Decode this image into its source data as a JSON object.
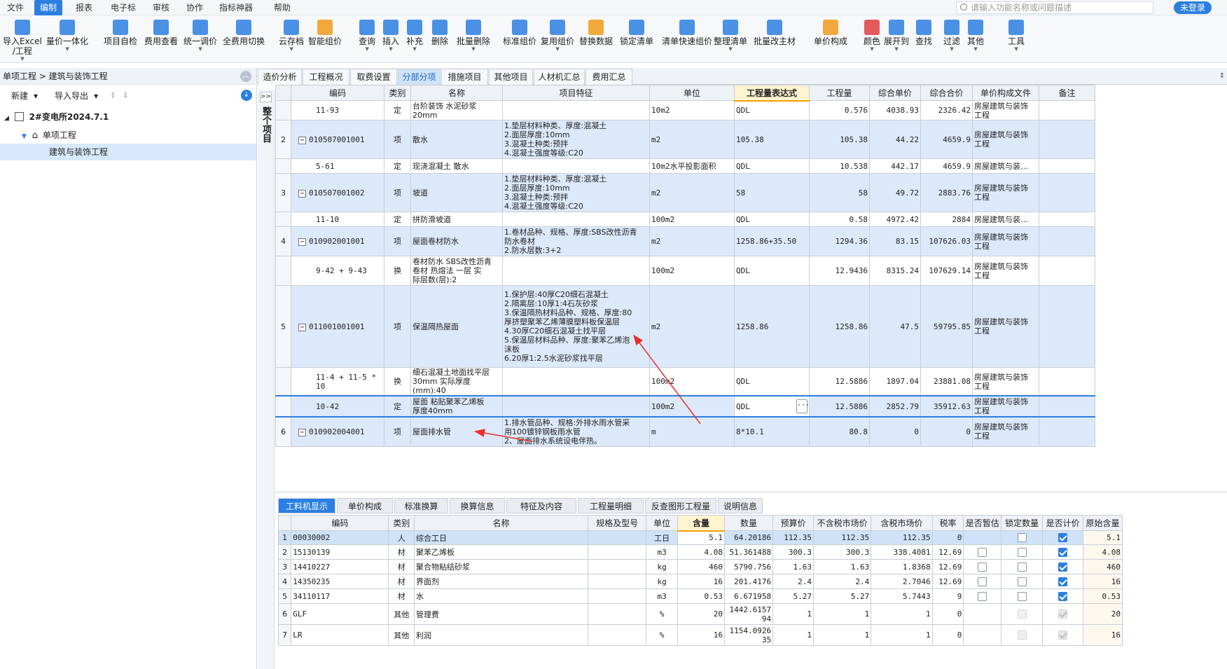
{
  "menu": [
    "文件",
    "编制",
    "报表",
    "电子标",
    "审核",
    "协作",
    "指标神器",
    "帮助"
  ],
  "menu_active_index": 1,
  "search_placeholder": "请输入功能名称或问题描述",
  "login_label": "未登录",
  "toolbar": [
    {
      "label": "导入Excel\n/工程",
      "icon": "import-excel-icon",
      "dd": true
    },
    {
      "label": "量价一体化",
      "icon": "quantity-price-icon",
      "dd": true
    },
    {
      "label": "项目自检",
      "icon": "self-check-icon",
      "dd": false
    },
    {
      "label": "费用查看",
      "icon": "fee-view-icon",
      "dd": false
    },
    {
      "label": "统一调价",
      "icon": "unified-price-icon",
      "dd": true
    },
    {
      "label": "全费用切换",
      "icon": "full-fee-switch-icon",
      "dd": false
    },
    {
      "label": "云存档",
      "icon": "cloud-archive-icon",
      "dd": true
    },
    {
      "label": "智能组价",
      "icon": "smart-pricing-icon",
      "dd": false
    },
    {
      "label": "查询",
      "icon": "query-icon",
      "dd": true
    },
    {
      "label": "插入",
      "icon": "insert-icon",
      "dd": true
    },
    {
      "label": "补充",
      "icon": "supplement-icon",
      "dd": true
    },
    {
      "label": "删除",
      "icon": "delete-icon",
      "dd": false
    },
    {
      "label": "批量删除",
      "icon": "batch-delete-icon",
      "dd": true
    },
    {
      "label": "标准组价",
      "icon": "standard-pricing-icon",
      "dd": false
    },
    {
      "label": "复用组价",
      "icon": "reuse-pricing-icon",
      "dd": true
    },
    {
      "label": "替换数据",
      "icon": "replace-data-icon",
      "dd": false
    },
    {
      "label": "锁定清单",
      "icon": "lock-list-icon",
      "dd": false
    },
    {
      "label": "清单快速组价",
      "icon": "quick-pricing-icon",
      "dd": false
    },
    {
      "label": "整理清单",
      "icon": "organize-list-icon",
      "dd": true
    },
    {
      "label": "批量改主材",
      "icon": "batch-material-icon",
      "dd": false
    },
    {
      "label": "单价构成",
      "icon": "unit-price-icon",
      "dd": false
    },
    {
      "label": "颜色",
      "icon": "color-icon",
      "dd": true
    },
    {
      "label": "展开到",
      "icon": "expand-to-icon",
      "dd": true
    },
    {
      "label": "查找",
      "icon": "find-icon",
      "dd": false
    },
    {
      "label": "过滤",
      "icon": "filter-icon",
      "dd": true
    },
    {
      "label": "其他",
      "icon": "other-icon",
      "dd": true
    },
    {
      "label": "工具",
      "icon": "tools-icon",
      "dd": true
    }
  ],
  "left": {
    "breadcrumb": "单项工程 > 建筑与装饰工程",
    "new_label": "新建",
    "import_export_label": "导入导出",
    "tree": [
      {
        "label": "2#变电所2024.7.1",
        "level": 0,
        "icon": "building-icon"
      },
      {
        "label": "单项工程",
        "level": 1,
        "icon": "home-icon"
      },
      {
        "label": "建筑与装饰工程",
        "level": 2,
        "icon": ""
      }
    ],
    "strip_label": "整个项目"
  },
  "tabs": [
    "造价分析",
    "工程概况",
    "取费设置",
    "分部分项",
    "措施项目",
    "其他项目",
    "人材机汇总",
    "费用汇总"
  ],
  "active_tab": "分部分项",
  "main_headers": [
    "",
    "编码",
    "类别",
    "名称",
    "项目特征",
    "单位",
    "工程量表达式",
    "工程量",
    "综合单价",
    "综合合价",
    "单价构成文件",
    "备注"
  ],
  "main_rows": [
    {
      "seq": "",
      "code": "11-93",
      "type": "定",
      "name": "台阶装饰 水泥砂浆\n20mm",
      "feature": "",
      "unit": "10m2",
      "expr": "QDL",
      "qty": "0.576",
      "price": "4038.93",
      "total": "2326.42",
      "file": "房屋建筑与装饰\n工程",
      "kind": "sub",
      "h": 28
    },
    {
      "seq": "2",
      "code": "010507001001",
      "type": "项",
      "name": "散水",
      "feature": "1.垫层材料种类、厚度:混凝土\n2.面层厚度:10mm\n3.混凝土种类:预拌\n4.混凝土强度等级:C20",
      "unit": "m2",
      "expr": "105.38",
      "qty": "105.38",
      "price": "44.22",
      "total": "4659.9",
      "file": "房屋建筑与装饰\n工程",
      "kind": "item",
      "h": 55
    },
    {
      "seq": "",
      "code": "5-61",
      "type": "定",
      "name": "现浇混凝土 散水",
      "feature": "",
      "unit": "10m2水平投影面积",
      "expr": "QDL",
      "qty": "10.538",
      "price": "442.17",
      "total": "4659.9",
      "file": "房屋建筑与装…",
      "kind": "sub",
      "h": 21
    },
    {
      "seq": "3",
      "code": "010507001002",
      "type": "项",
      "name": "坡道",
      "feature": "1.垫层材料种类、厚度:混凝土\n2.面层厚度:10mm\n3.混凝土种类:预拌\n4.混凝土强度等级:C20",
      "unit": "m2",
      "expr": "58",
      "qty": "58",
      "price": "49.72",
      "total": "2883.76",
      "file": "房屋建筑与装饰\n工程",
      "kind": "item",
      "h": 55
    },
    {
      "seq": "",
      "code": "11-10",
      "type": "定",
      "name": "拼防滑坡道",
      "feature": "",
      "unit": "100m2",
      "expr": "QDL",
      "qty": "0.58",
      "price": "4972.42",
      "total": "2884",
      "file": "房屋建筑与装…",
      "kind": "sub",
      "h": 21
    },
    {
      "seq": "4",
      "code": "010902001001",
      "type": "项",
      "name": "屋面卷材防水",
      "feature": "1.卷材品种、规格、厚度:SBS改性沥青\n防水卷材\n2.防水层数:3+2",
      "unit": "m2",
      "expr": "1258.86+35.50",
      "qty": "1294.36",
      "price": "83.15",
      "total": "107626.03",
      "file": "房屋建筑与装饰\n工程",
      "kind": "item",
      "h": 42
    },
    {
      "seq": "",
      "code": "9-42 + 9-43",
      "type": "换",
      "name": "卷材防水 SBS改性沥青\n卷材 热熔法 一层 实\n际层数(层):2",
      "feature": "",
      "unit": "100m2",
      "expr": "QDL",
      "qty": "12.9436",
      "price": "8315.24",
      "total": "107629.14",
      "file": "房屋建筑与装饰\n工程",
      "kind": "sub",
      "h": 42
    },
    {
      "seq": "5",
      "code": "011001001001",
      "type": "项",
      "name": "保温隔热屋面",
      "feature": "1.保护层:40厚C20细石混凝土\n2.隔离层:10厚1:4石灰砂浆\n3.保温隔热材料品种、规格、厚度:80\n厚挤塑聚苯乙烯薄膜塑料板保温层\n4.30厚C20细石混凝土找平层\n5.保温层材料品种、厚度:聚苯乙烯泡\n沫板\n6.20厚1:2.5水泥砂浆找平层",
      "unit": "m2",
      "expr": "1258.86",
      "qty": "1258.86",
      "price": "47.5",
      "total": "59795.85",
      "file": "房屋建筑与装饰\n工程",
      "kind": "item",
      "h": 117
    },
    {
      "seq": "",
      "code": "11-4 + 11-5 *\n10",
      "type": "换",
      "name": "细石混凝土地面找平层\n30mm  实际厚度(mm):40",
      "feature": "",
      "unit": "100m2",
      "expr": "QDL",
      "qty": "12.5886",
      "price": "1897.04",
      "total": "23881.08",
      "file": "房屋建筑与装饰\n工程",
      "kind": "sub",
      "h": 30
    },
    {
      "seq": "",
      "code": "10-42",
      "type": "定",
      "name": "屋面 粘贴聚苯乙烯板\n厚度40mm",
      "feature": "",
      "unit": "100m2",
      "expr": "QDL",
      "qty": "12.5886",
      "price": "2852.79",
      "total": "35912.63",
      "file": "房屋建筑与装饰\n工程",
      "kind": "cur",
      "h": 30
    },
    {
      "seq": "6",
      "code": "010902004001",
      "type": "项",
      "name": "屋面排水管",
      "feature": "1.排水管品种、规格:外排水雨水管采\n用100镀锌钢板雨水管\n2、屋面排水系统设电伴热。",
      "unit": "m",
      "expr": "8*10.1",
      "qty": "80.8",
      "price": "0",
      "total": "0",
      "file": "房屋建筑与装饰\n工程",
      "kind": "item",
      "h": 42
    }
  ],
  "bottom_tabs": [
    "工料机显示",
    "单价构成",
    "标准换算",
    "换算信息",
    "特征及内容",
    "工程量明细",
    "反查图形工程量",
    "说明信息"
  ],
  "bottom_active": "工料机显示",
  "bottom_headers": [
    "",
    "编码",
    "类别",
    "名称",
    "规格及型号",
    "单位",
    "含量",
    "数量",
    "预算价",
    "不含税市场价",
    "含税市场价",
    "税率",
    "是否暂估",
    "锁定数量",
    "是否计价",
    "原始含量"
  ],
  "bottom_rows": [
    {
      "seq": "1",
      "code": "00030002",
      "type": "人",
      "name": "综合工日",
      "spec": "",
      "unit": "工日",
      "content": "5.1",
      "qty": "64.20186",
      "budget": "112.35",
      "market_ex": "112.35",
      "market_in": "112.35",
      "tax": "0",
      "est": false,
      "lock": false,
      "priced": true,
      "orig": "5.1",
      "cbdis": false,
      "h": 20
    },
    {
      "seq": "2",
      "code": "15130139",
      "type": "材",
      "name": "聚苯乙烯板",
      "spec": "",
      "unit": "m3",
      "content": "4.08",
      "qty": "51.361488",
      "budget": "300.3",
      "market_ex": "300.3",
      "market_in": "338.4081",
      "tax": "12.69",
      "est": false,
      "lock": false,
      "priced": true,
      "orig": "4.08",
      "cbdis": false,
      "h": 21
    },
    {
      "seq": "3",
      "code": "14410227",
      "type": "材",
      "name": "聚合物粘结砂浆",
      "spec": "",
      "unit": "kg",
      "content": "460",
      "qty": "5790.756",
      "budget": "1.63",
      "market_ex": "1.63",
      "market_in": "1.8368",
      "tax": "12.69",
      "est": false,
      "lock": false,
      "priced": true,
      "orig": "460",
      "cbdis": false,
      "h": 21
    },
    {
      "seq": "4",
      "code": "14350235",
      "type": "材",
      "name": "界面剂",
      "spec": "",
      "unit": "kg",
      "content": "16",
      "qty": "201.4176",
      "budget": "2.4",
      "market_ex": "2.4",
      "market_in": "2.7046",
      "tax": "12.69",
      "est": false,
      "lock": false,
      "priced": true,
      "orig": "16",
      "cbdis": false,
      "h": 21
    },
    {
      "seq": "5",
      "code": "34110117",
      "type": "材",
      "name": "水",
      "spec": "",
      "unit": "m3",
      "content": "0.53",
      "qty": "6.671958",
      "budget": "5.27",
      "market_ex": "5.27",
      "market_in": "5.7443",
      "tax": "9",
      "est": false,
      "lock": false,
      "priced": true,
      "orig": "0.53",
      "cbdis": false,
      "h": 21
    },
    {
      "seq": "6",
      "code": "GLF",
      "type": "其他",
      "name": "管理费",
      "spec": "",
      "unit": "%",
      "content": "20",
      "qty": "1442.6157\n94",
      "budget": "1",
      "market_ex": "1",
      "market_in": "1",
      "tax": "0",
      "est": false,
      "lock": false,
      "priced": true,
      "orig": "20",
      "cbdis": true,
      "h": 30
    },
    {
      "seq": "7",
      "code": "LR",
      "type": "其他",
      "name": "利润",
      "spec": "",
      "unit": "%",
      "content": "16",
      "qty": "1154.0926\n35",
      "budget": "1",
      "market_ex": "1",
      "market_in": "1",
      "tax": "0",
      "est": false,
      "lock": false,
      "priced": true,
      "orig": "16",
      "cbdis": true,
      "h": 30
    }
  ],
  "colors": {
    "accent": "#2b7fe0",
    "item_row": "#dce9fa",
    "annotation_arrow": "#e8302a"
  }
}
